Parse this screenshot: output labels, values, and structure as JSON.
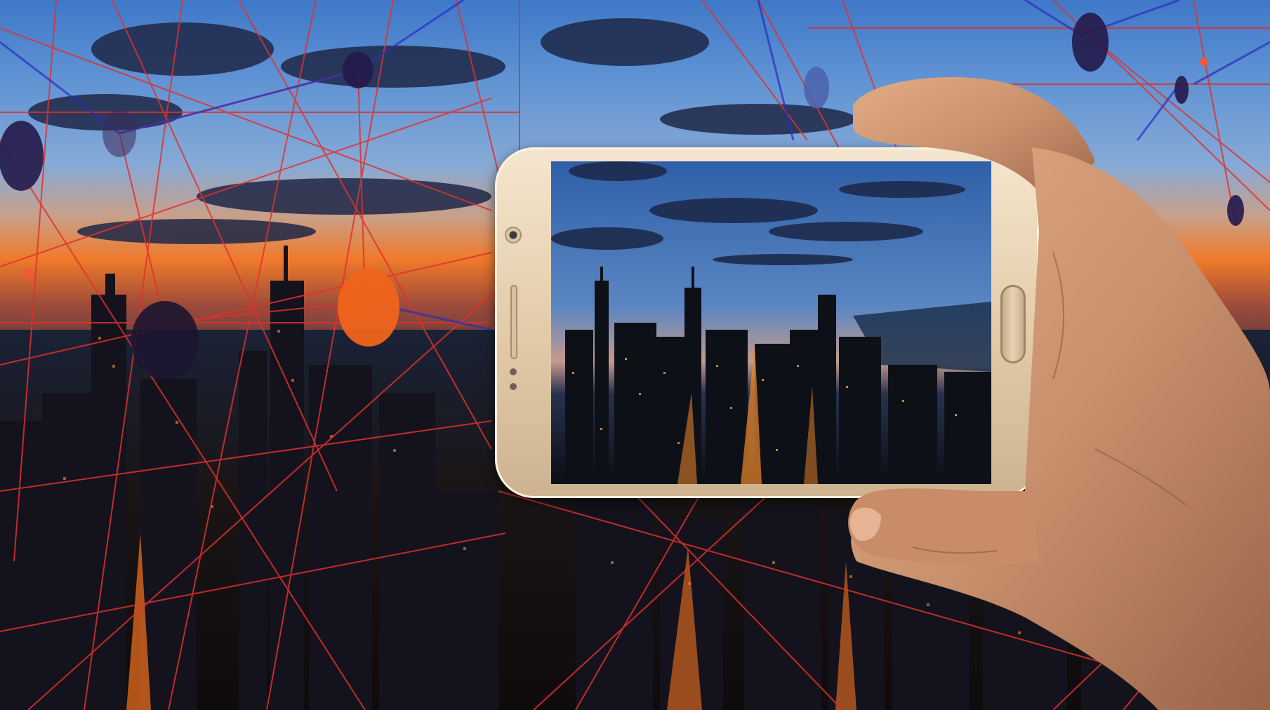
{
  "scene": {
    "description_colors": {
      "network_line": "#e0312d",
      "node_dark": "#241a4a",
      "node_sun": "#f0641a",
      "phone_body": "#e6cfae",
      "skin": "#c8906c"
    },
    "icons": [
      "camera-icon",
      "home-button-icon",
      "speaker-icon"
    ]
  }
}
